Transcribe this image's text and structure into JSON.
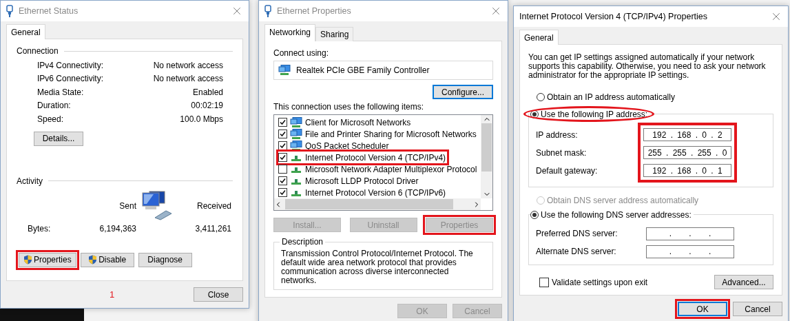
{
  "ethernet_status": {
    "title": "Ethernet Status",
    "tabs": [
      {
        "label": "General",
        "selected": true
      }
    ],
    "connection": {
      "heading": "Connection",
      "rows": [
        {
          "label": "IPv4 Connectivity:",
          "value": "No network access"
        },
        {
          "label": "IPv6 Connectivity:",
          "value": "No network access"
        },
        {
          "label": "Media State:",
          "value": "Enabled"
        },
        {
          "label": "Duration:",
          "value": "00:02:19"
        },
        {
          "label": "Speed:",
          "value": "100.0 Mbps"
        }
      ]
    },
    "details_button": "Details...",
    "activity": {
      "heading": "Activity",
      "sent_label": "Sent",
      "received_label": "Received",
      "bytes_label": "Bytes:",
      "sent": "6,194,363",
      "received": "3,411,261"
    },
    "buttons": [
      {
        "label": "Properties",
        "shield": true,
        "highlighted": true
      },
      {
        "label": "Disable",
        "shield": true,
        "highlighted": false
      },
      {
        "label": "Diagnose",
        "shield": false,
        "highlighted": false
      }
    ],
    "step_number": "1",
    "close_button": "Close"
  },
  "ethernet_properties": {
    "title": "Ethernet Properties",
    "tabs": [
      {
        "label": "Networking",
        "selected": true
      },
      {
        "label": "Sharing",
        "selected": false
      }
    ],
    "connect_using_label": "Connect using:",
    "adapter": "Realtek PCIe GBE Family Controller",
    "configure_button": "Configure...",
    "items_label": "This connection uses the following items:",
    "items": [
      {
        "label": "Client for Microsoft Networks",
        "checked": true,
        "highlighted": false,
        "kind": "client"
      },
      {
        "label": "File and Printer Sharing for Microsoft Networks",
        "checked": true,
        "highlighted": false,
        "kind": "client"
      },
      {
        "label": "QoS Packet Scheduler",
        "checked": true,
        "highlighted": false,
        "kind": "client"
      },
      {
        "label": "Internet Protocol Version 4 (TCP/IPv4)",
        "checked": true,
        "highlighted": true,
        "kind": "protocol"
      },
      {
        "label": "Microsoft Network Adapter Multiplexor Protocol",
        "checked": false,
        "highlighted": false,
        "kind": "protocol"
      },
      {
        "label": "Microsoft LLDP Protocol Driver",
        "checked": true,
        "highlighted": false,
        "kind": "protocol"
      },
      {
        "label": "Internet Protocol Version 6 (TCP/IPv6)",
        "checked": true,
        "highlighted": false,
        "kind": "protocol"
      }
    ],
    "buttons": [
      {
        "label": "Install...",
        "disabled": true,
        "highlighted": false
      },
      {
        "label": "Uninstall",
        "disabled": true,
        "highlighted": false
      },
      {
        "label": "Properties",
        "disabled": true,
        "highlighted": true
      }
    ],
    "description_heading": "Description",
    "description": "Transmission Control Protocol/Internet Protocol. The default wide area network protocol that provides communication across diverse interconnected networks.",
    "footer_buttons": [
      {
        "label": "OK",
        "disabled": true
      },
      {
        "label": "Cancel",
        "disabled": true
      }
    ]
  },
  "ipv4_properties": {
    "title": "Internet Protocol Version 4 (TCP/IPv4) Properties",
    "tabs": [
      {
        "label": "General",
        "selected": true
      }
    ],
    "intro": "You can get IP settings assigned automatically if your network supports this capability. Otherwise, you need to ask your network administrator for the appropriate IP settings.",
    "ip_options": [
      {
        "label": "Obtain an IP address automatically",
        "selected": false,
        "disabled": false,
        "highlighted": false
      },
      {
        "label": "Use the following IP address:",
        "selected": true,
        "disabled": false,
        "highlighted": true
      }
    ],
    "ip_fields_highlighted": true,
    "ip_fields": [
      {
        "label": "IP address:",
        "value": "192 . 168 . 0 . 2"
      },
      {
        "label": "Subnet mask:",
        "value": "255 . 255 . 255 . 0"
      },
      {
        "label": "Default gateway:",
        "value": "192 . 168 . 0 . 1"
      }
    ],
    "dns_options": [
      {
        "label": "Obtain DNS server address automatically",
        "selected": false,
        "disabled": true
      },
      {
        "label": "Use the following DNS server addresses:",
        "selected": true,
        "disabled": false
      }
    ],
    "dns_fields": [
      {
        "label": "Preferred DNS server:",
        "value": ". . ."
      },
      {
        "label": "Alternate DNS server:",
        "value": ". . ."
      }
    ],
    "validate": {
      "label": "Validate settings upon exit",
      "checked": false
    },
    "advanced_button": "Advanced...",
    "footer_buttons": [
      {
        "label": "OK",
        "highlighted": true
      },
      {
        "label": "Cancel",
        "highlighted": false
      }
    ]
  }
}
